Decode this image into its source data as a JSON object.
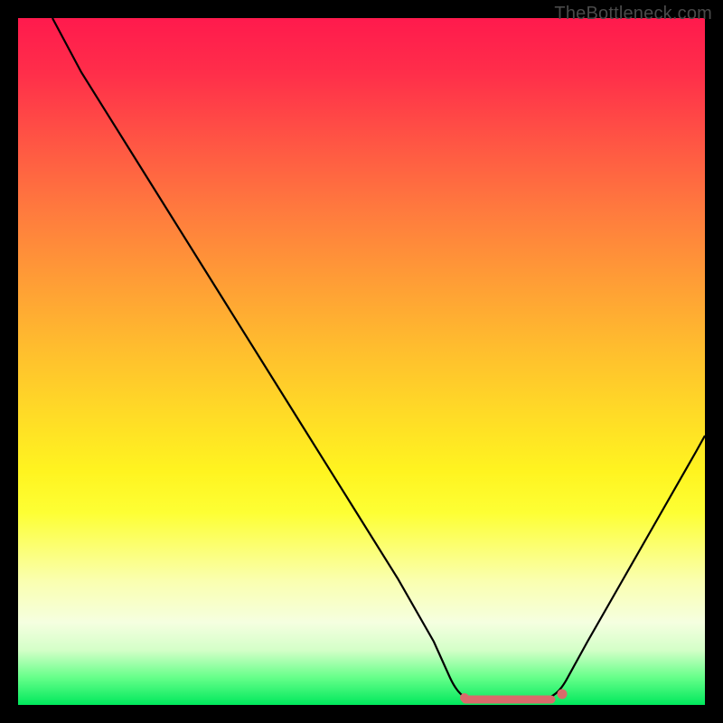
{
  "watermark": "TheBottleneck.com",
  "chart_data": {
    "type": "line",
    "title": "",
    "xlabel": "",
    "ylabel": "",
    "xlim": [
      0,
      100
    ],
    "ylim": [
      0,
      100
    ],
    "series": [
      {
        "name": "bottleneck-curve",
        "x": [
          5,
          10,
          15,
          20,
          25,
          30,
          35,
          40,
          45,
          50,
          55,
          60,
          62,
          65,
          68,
          72,
          75,
          78,
          80,
          85,
          90,
          95,
          100
        ],
        "y": [
          100,
          92,
          84,
          76,
          68,
          60,
          52,
          44,
          36,
          28,
          20,
          12,
          6,
          2,
          0.5,
          0.5,
          0.5,
          0.5,
          2,
          10,
          20,
          30,
          42
        ]
      }
    ],
    "markers": [
      {
        "name": "flat-segment-left",
        "x": 65,
        "y": 0.5
      },
      {
        "name": "flat-segment-right",
        "x": 78,
        "y": 0.5
      }
    ],
    "marker_color": "#d96b6b",
    "curve_color": "#000000",
    "gradient_stops": [
      {
        "pos": 0,
        "color": "#ff1a4d"
      },
      {
        "pos": 18,
        "color": "#ff5544"
      },
      {
        "pos": 38,
        "color": "#ff9c36"
      },
      {
        "pos": 58,
        "color": "#ffdc26"
      },
      {
        "pos": 72,
        "color": "#fdff34"
      },
      {
        "pos": 88,
        "color": "#f5ffe0"
      },
      {
        "pos": 96,
        "color": "#66ff8a"
      },
      {
        "pos": 100,
        "color": "#00e85c"
      }
    ]
  }
}
